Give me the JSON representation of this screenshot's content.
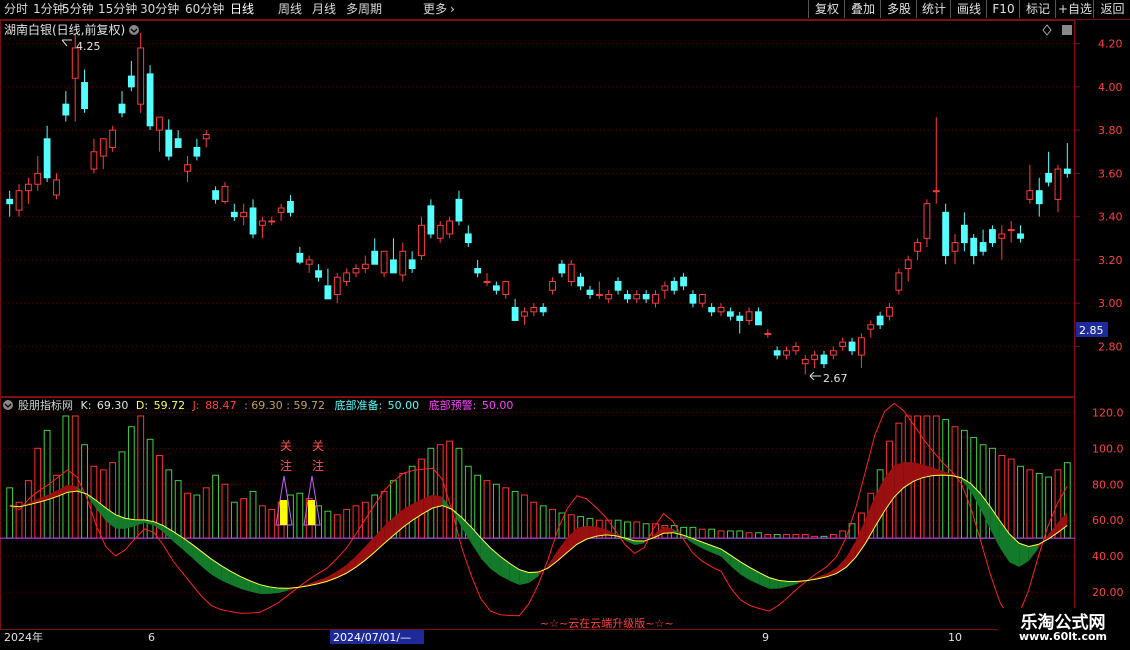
{
  "toolbar": {
    "periods": [
      "分时",
      "1分钟",
      "5分钟",
      "15分钟",
      "30分钟",
      "60分钟",
      "日线",
      "周线",
      "月线",
      "多周期",
      "更多"
    ],
    "active_period": "日线",
    "right_buttons": [
      "复权",
      "叠加",
      "多股",
      "统计",
      "画线",
      "F10",
      "标记",
      "+自选",
      "返回"
    ]
  },
  "main_panel": {
    "title": "湖南白银(日线,前复权)",
    "price_axis_labels": [
      "4.20",
      "4.00",
      "3.80",
      "3.60",
      "3.40",
      "3.20",
      "3.00",
      "2.80"
    ],
    "current_price": "2.85",
    "high_marker": "4.25",
    "low_marker": "2.67"
  },
  "indicator_panel": {
    "name": "股朋指标网",
    "k_label": "K:",
    "k_value": "69.30",
    "d_label": "D:",
    "d_value": "59.72",
    "j_label": "J:",
    "j_value": "88.47",
    "extra_values": ": 69.30 : 59.72",
    "bottom_ready_label": "底部准备:",
    "bottom_ready_value": "50.00",
    "bottom_warn_label": "底部预警:",
    "bottom_warn_value": "50.00",
    "axis_labels": [
      "120.0",
      "100.0",
      "80.00",
      "60.00",
      "40.00",
      "20.00"
    ],
    "focus_marks": [
      [
        "关",
        "注"
      ],
      [
        "关",
        "注"
      ]
    ],
    "footer_text": "~☆~云在云端升级版~☆~"
  },
  "date_axis": {
    "labels": [
      "2024年",
      "6",
      "2024/07/01/—",
      "9",
      "10"
    ]
  },
  "watermark": {
    "title": "乐淘公式网",
    "url": "www.60lt.com"
  },
  "colors": {
    "up": "#ff3b3b",
    "down": "#54ffff",
    "ma": "#ffff00",
    "bg": "#000000"
  },
  "chart_data": {
    "type": "candlestick",
    "price_range": [
      2.58,
      4.3
    ],
    "candles": [
      [
        3.48,
        3.52,
        3.4,
        3.46
      ],
      [
        3.43,
        3.55,
        3.4,
        3.52
      ],
      [
        3.52,
        3.58,
        3.46,
        3.55
      ],
      [
        3.55,
        3.68,
        3.52,
        3.6
      ],
      [
        3.76,
        3.82,
        3.56,
        3.58
      ],
      [
        3.5,
        3.6,
        3.48,
        3.57
      ],
      [
        3.92,
        3.98,
        3.84,
        3.87
      ],
      [
        4.04,
        4.25,
        3.84,
        4.18
      ],
      [
        4.02,
        4.08,
        3.88,
        3.9
      ],
      [
        3.62,
        3.76,
        3.6,
        3.7
      ],
      [
        3.68,
        3.76,
        3.62,
        3.76
      ],
      [
        3.72,
        3.82,
        3.7,
        3.8
      ],
      [
        3.92,
        3.98,
        3.86,
        3.88
      ],
      [
        4.05,
        4.12,
        3.98,
        4.0
      ],
      [
        3.92,
        4.25,
        3.88,
        4.18
      ],
      [
        4.06,
        4.1,
        3.8,
        3.82
      ],
      [
        3.8,
        3.86,
        3.7,
        3.86
      ],
      [
        3.8,
        3.85,
        3.66,
        3.68
      ],
      [
        3.76,
        3.8,
        3.72,
        3.72
      ],
      [
        3.61,
        3.68,
        3.56,
        3.64
      ],
      [
        3.72,
        3.76,
        3.66,
        3.68
      ],
      [
        3.76,
        3.8,
        3.72,
        3.78
      ],
      [
        3.52,
        3.54,
        3.46,
        3.48
      ],
      [
        3.47,
        3.56,
        3.46,
        3.54
      ],
      [
        3.42,
        3.46,
        3.38,
        3.4
      ],
      [
        3.4,
        3.46,
        3.36,
        3.42
      ],
      [
        3.44,
        3.48,
        3.3,
        3.32
      ],
      [
        3.36,
        3.4,
        3.3,
        3.38
      ],
      [
        3.38,
        3.4,
        3.36,
        3.38
      ],
      [
        3.42,
        3.46,
        3.38,
        3.44
      ],
      [
        3.47,
        3.5,
        3.4,
        3.42
      ],
      [
        3.23,
        3.26,
        3.18,
        3.19
      ],
      [
        3.18,
        3.22,
        3.14,
        3.2
      ],
      [
        3.15,
        3.18,
        3.1,
        3.12
      ],
      [
        3.08,
        3.16,
        3.02,
        3.02
      ],
      [
        3.04,
        3.14,
        3.0,
        3.12
      ],
      [
        3.1,
        3.16,
        3.08,
        3.14
      ],
      [
        3.14,
        3.18,
        3.12,
        3.16
      ],
      [
        3.16,
        3.22,
        3.14,
        3.18
      ],
      [
        3.24,
        3.3,
        3.18,
        3.18
      ],
      [
        3.14,
        3.24,
        3.12,
        3.24
      ],
      [
        3.2,
        3.3,
        3.14,
        3.14
      ],
      [
        3.13,
        3.28,
        3.1,
        3.24
      ],
      [
        3.2,
        3.24,
        3.14,
        3.16
      ],
      [
        3.22,
        3.4,
        3.2,
        3.36
      ],
      [
        3.45,
        3.48,
        3.3,
        3.32
      ],
      [
        3.3,
        3.38,
        3.28,
        3.36
      ],
      [
        3.32,
        3.4,
        3.3,
        3.38
      ],
      [
        3.48,
        3.52,
        3.36,
        3.38
      ],
      [
        3.32,
        3.36,
        3.26,
        3.28
      ],
      [
        3.16,
        3.2,
        3.12,
        3.14
      ],
      [
        3.1,
        3.14,
        3.08,
        3.1
      ],
      [
        3.08,
        3.1,
        3.04,
        3.06
      ],
      [
        3.04,
        3.1,
        3.02,
        3.1
      ],
      [
        2.98,
        3.02,
        2.92,
        2.92
      ],
      [
        2.94,
        2.98,
        2.9,
        2.96
      ],
      [
        2.96,
        3.0,
        2.94,
        2.98
      ],
      [
        2.98,
        3.0,
        2.94,
        2.96
      ],
      [
        3.06,
        3.12,
        3.04,
        3.1
      ],
      [
        3.18,
        3.2,
        3.12,
        3.14
      ],
      [
        3.1,
        3.2,
        3.08,
        3.18
      ],
      [
        3.12,
        3.14,
        3.06,
        3.08
      ],
      [
        3.06,
        3.08,
        3.02,
        3.04
      ],
      [
        3.04,
        3.1,
        3.02,
        3.04
      ],
      [
        3.02,
        3.06,
        3.0,
        3.04
      ],
      [
        3.1,
        3.12,
        3.04,
        3.06
      ],
      [
        3.04,
        3.06,
        3.0,
        3.02
      ],
      [
        3.02,
        3.06,
        3.0,
        3.04
      ],
      [
        3.04,
        3.06,
        3.0,
        3.02
      ],
      [
        3.0,
        3.06,
        2.98,
        3.04
      ],
      [
        3.06,
        3.1,
        3.02,
        3.08
      ],
      [
        3.1,
        3.12,
        3.04,
        3.06
      ],
      [
        3.12,
        3.14,
        3.06,
        3.08
      ],
      [
        3.04,
        3.06,
        2.98,
        3.0
      ],
      [
        3.0,
        3.04,
        2.98,
        3.04
      ],
      [
        2.98,
        3.0,
        2.94,
        2.96
      ],
      [
        2.96,
        3.0,
        2.94,
        2.98
      ],
      [
        2.96,
        2.98,
        2.92,
        2.94
      ],
      [
        2.94,
        2.96,
        2.86,
        2.92
      ],
      [
        2.92,
        2.98,
        2.9,
        2.96
      ],
      [
        2.96,
        2.98,
        2.9,
        2.9
      ],
      [
        2.86,
        2.88,
        2.84,
        2.86
      ],
      [
        2.78,
        2.8,
        2.74,
        2.76
      ],
      [
        2.76,
        2.8,
        2.74,
        2.78
      ],
      [
        2.78,
        2.82,
        2.76,
        2.8
      ],
      [
        2.72,
        2.76,
        2.67,
        2.74
      ],
      [
        2.74,
        2.78,
        2.7,
        2.76
      ],
      [
        2.76,
        2.78,
        2.7,
        2.72
      ],
      [
        2.76,
        2.8,
        2.74,
        2.78
      ],
      [
        2.8,
        2.84,
        2.78,
        2.82
      ],
      [
        2.82,
        2.84,
        2.76,
        2.78
      ],
      [
        2.76,
        2.86,
        2.7,
        2.84
      ],
      [
        2.88,
        2.92,
        2.84,
        2.9
      ],
      [
        2.94,
        2.96,
        2.88,
        2.9
      ],
      [
        2.94,
        3.0,
        2.92,
        2.98
      ],
      [
        3.06,
        3.16,
        3.04,
        3.14
      ],
      [
        3.16,
        3.22,
        3.1,
        3.2
      ],
      [
        3.24,
        3.3,
        3.2,
        3.28
      ],
      [
        3.3,
        3.48,
        3.26,
        3.46
      ],
      [
        3.52,
        3.86,
        3.46,
        3.52
      ],
      [
        3.42,
        3.46,
        3.18,
        3.22
      ],
      [
        3.24,
        3.32,
        3.18,
        3.28
      ],
      [
        3.36,
        3.42,
        3.24,
        3.28
      ],
      [
        3.3,
        3.32,
        3.18,
        3.22
      ],
      [
        3.28,
        3.34,
        3.22,
        3.24
      ],
      [
        3.34,
        3.36,
        3.26,
        3.28
      ],
      [
        3.3,
        3.36,
        3.2,
        3.32
      ],
      [
        3.34,
        3.38,
        3.28,
        3.34
      ],
      [
        3.32,
        3.36,
        3.28,
        3.3
      ],
      [
        3.48,
        3.64,
        3.46,
        3.52
      ],
      [
        3.52,
        3.58,
        3.4,
        3.46
      ],
      [
        3.6,
        3.7,
        3.54,
        3.56
      ],
      [
        3.48,
        3.64,
        3.42,
        3.62
      ],
      [
        3.62,
        3.74,
        3.58,
        3.6
      ]
    ],
    "volumes": [
      48,
      40,
      52,
      70,
      80,
      55,
      95,
      90,
      72,
      60,
      58,
      62,
      68,
      82,
      90,
      75,
      66,
      58,
      52,
      45,
      44,
      48,
      55,
      50,
      40,
      42,
      46,
      38,
      36,
      40,
      44,
      45,
      42,
      38,
      35,
      33,
      36,
      38,
      40,
      44,
      46,
      52,
      56,
      60,
      64,
      70,
      72,
      74,
      70,
      60,
      55,
      52,
      50,
      48,
      46,
      44,
      40,
      38,
      36,
      34,
      33,
      32,
      31,
      30,
      30,
      30,
      29,
      29,
      28,
      28,
      27,
      27,
      26,
      26,
      25,
      25,
      24,
      24,
      24,
      23,
      23,
      22,
      22,
      22,
      22,
      22,
      21,
      21,
      22,
      24,
      28,
      34,
      45,
      58,
      74,
      84,
      90,
      96,
      100,
      92,
      86,
      82,
      80,
      76,
      72,
      70,
      66,
      64,
      60,
      58,
      56,
      54,
      58,
      62
    ],
    "k_series": [
      68,
      66,
      72,
      74,
      76,
      79,
      82,
      78,
      70,
      60,
      54,
      52,
      55,
      58,
      60,
      56,
      50,
      44,
      40,
      35,
      30,
      26,
      24,
      22,
      20,
      19,
      18,
      19,
      20,
      22,
      24,
      26,
      28,
      30,
      34,
      38,
      44,
      50,
      56,
      62,
      66,
      70,
      72,
      74,
      76,
      72,
      60,
      48,
      40,
      32,
      28,
      26,
      24,
      22,
      26,
      32,
      40,
      50,
      56,
      60,
      58,
      56,
      54,
      50,
      46,
      44,
      48,
      56,
      60,
      54,
      48,
      44,
      42,
      40,
      38,
      30,
      26,
      24,
      22,
      20,
      22,
      24,
      26,
      28,
      30,
      32,
      36,
      44,
      56,
      70,
      84,
      92,
      96,
      94,
      92,
      90,
      88,
      86,
      84,
      80,
      70,
      58,
      46,
      36,
      30,
      32,
      40,
      50,
      58,
      64,
      69
    ]
  }
}
